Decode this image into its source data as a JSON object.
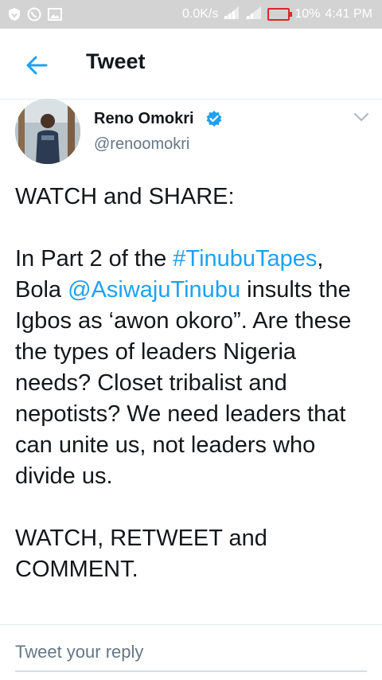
{
  "status_bar": {
    "net_speed": "0.0K/s",
    "battery": "10%",
    "time": "4:41 PM",
    "bg_color": "#d3d3d3",
    "battery_color": "#e0262b"
  },
  "header": {
    "title": "Tweet",
    "back_icon": "arrow-left-icon",
    "accent": "#1da1f2"
  },
  "tweet": {
    "author_name": "Reno Omokri",
    "handle": "@renoomokri",
    "verified": true,
    "line1": "WATCH and SHARE:",
    "para2_prefix": "In Part 2 of the ",
    "hashtag": "#TinubuTapes",
    "para2_comma": ",",
    "para2_bola": "Bola ",
    "mention": "@AsiwajuTinubu",
    "para2_rest": " insults the Igbos as ‘awon okoro”. Are these the types of leaders Nigeria needs? Closet tribalist and nepotists? We need leaders that can unite us, not leaders who divide us.",
    "para3": "WATCH, RETWEET and COMMENT."
  },
  "reply": {
    "placeholder": "Tweet your reply"
  }
}
